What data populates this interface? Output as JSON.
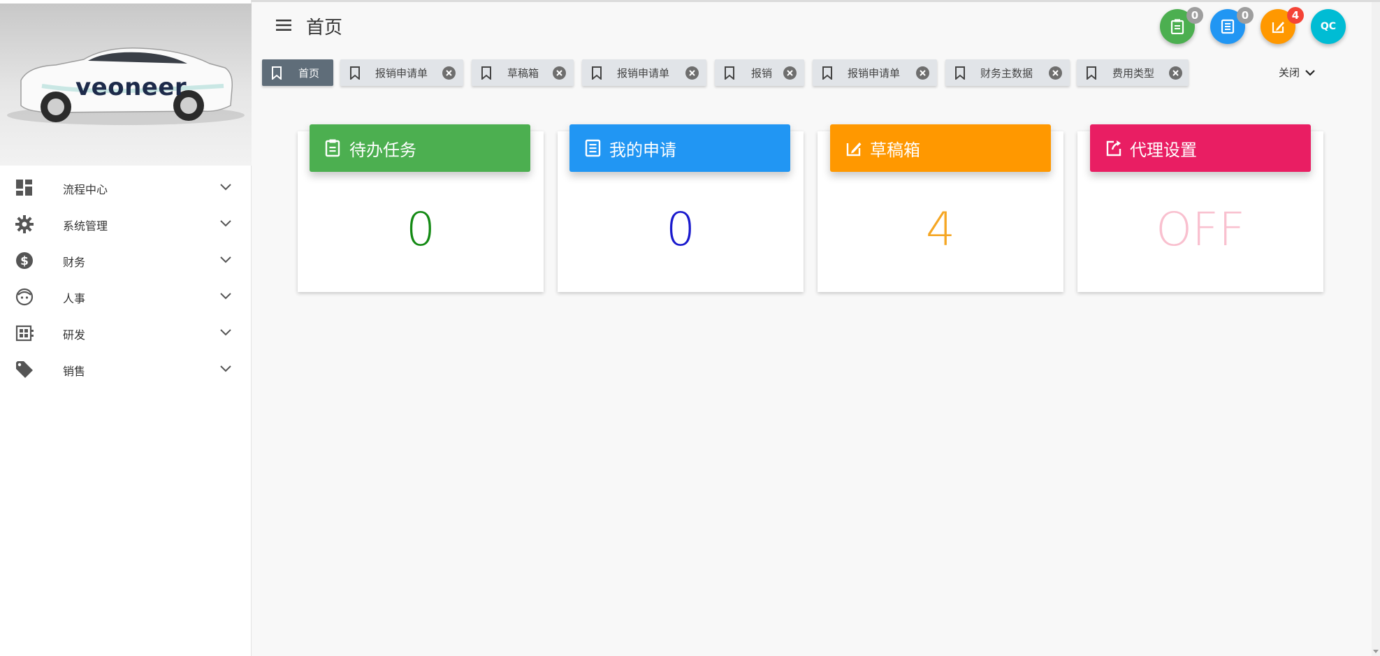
{
  "app": {
    "logo_text": "veoneer",
    "page_title": "首页"
  },
  "header": {
    "actions": [
      {
        "name": "todo",
        "icon": "clipboard-icon",
        "color": "#4caf50",
        "badge": "0",
        "badge_color": "#9e9e9e"
      },
      {
        "name": "my-requests",
        "icon": "list-doc-icon",
        "color": "#2196f3",
        "badge": "0",
        "badge_color": "#9e9e9e"
      },
      {
        "name": "drafts",
        "icon": "edit-note-icon",
        "color": "#ff9800",
        "badge": "4",
        "badge_color": "#f44336"
      }
    ],
    "avatar": {
      "initials": "QC",
      "color": "#00bcd4"
    }
  },
  "sidebar": {
    "items": [
      {
        "label": "流程中心",
        "icon": "dashboard-icon"
      },
      {
        "label": "系统管理",
        "icon": "gear-icon"
      },
      {
        "label": "财务",
        "icon": "dollar-icon"
      },
      {
        "label": "人事",
        "icon": "face-icon"
      },
      {
        "label": "研发",
        "icon": "chip-icon"
      },
      {
        "label": "销售",
        "icon": "tag-icon"
      }
    ]
  },
  "tabs": [
    {
      "label": "首页",
      "active": true,
      "closable": false
    },
    {
      "label": "报销申请单",
      "active": false,
      "closable": true
    },
    {
      "label": "草稿箱",
      "active": false,
      "closable": true
    },
    {
      "label": "报销申请单",
      "active": false,
      "closable": true
    },
    {
      "label": "报销",
      "active": false,
      "closable": true
    },
    {
      "label": "报销申请单",
      "active": false,
      "closable": true
    },
    {
      "label": "财务主数据",
      "active": false,
      "closable": true
    },
    {
      "label": "费用类型",
      "active": false,
      "closable": true
    }
  ],
  "close_all_label": "关闭",
  "cards": [
    {
      "title": "待办任务",
      "value": "0",
      "head_color": "#4caf50",
      "value_color": "#148a14",
      "icon": "clipboard-icon"
    },
    {
      "title": "我的申请",
      "value": "0",
      "head_color": "#2196f3",
      "value_color": "#1a1acd",
      "icon": "list-doc-icon"
    },
    {
      "title": "草稿箱",
      "value": "4",
      "head_color": "#ff9800",
      "value_color": "#f5a623",
      "icon": "edit-note-icon"
    },
    {
      "title": "代理设置",
      "value": "OFF",
      "head_color": "#e91e63",
      "value_color": "#f9c0cf",
      "icon": "share-icon"
    }
  ]
}
